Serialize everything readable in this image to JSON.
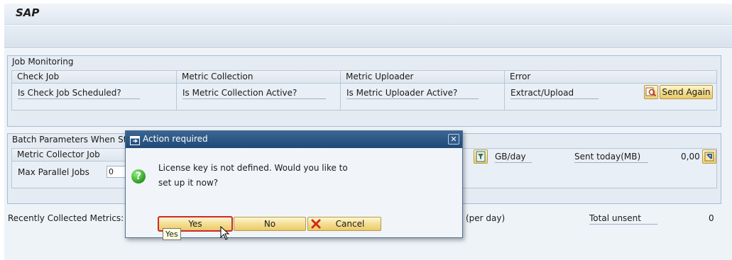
{
  "app": {
    "title": "SAP"
  },
  "job_monitoring": {
    "title": "Job Monitoring",
    "columns": [
      {
        "header": "Check Job",
        "label": "Is Check Job Scheduled?"
      },
      {
        "header": "Metric Collection",
        "label": "Is Metric Collection Active?"
      },
      {
        "header": "Metric Uploader",
        "label": "Is Metric Uploader Active?"
      },
      {
        "header": "Error",
        "label": "Extract/Upload"
      }
    ],
    "send_again_label": "Send Again"
  },
  "batch": {
    "title": "Batch Parameters When Star",
    "collector_header": "Metric Collector Job",
    "max_parallel_label": "Max Parallel Jobs",
    "max_parallel_value": "0",
    "gb_day_label": "GB/day",
    "sent_today_label": "Sent today(MB)",
    "sent_today_value": "0,00"
  },
  "footer": {
    "recent_label": "Recently Collected Metrics:",
    "per_day_label": "(per day)",
    "total_unsent_label": "Total unsent",
    "total_unsent_value": "0"
  },
  "dialog": {
    "title": "Action required",
    "message_line1": "License key is not defined. Would you like to",
    "message_line2": "set up it now?",
    "yes_label": "Yes",
    "no_label": "No",
    "cancel_label": "Cancel",
    "close_glyph": "✕",
    "tooltip": "Yes"
  },
  "icons": {
    "dialog_title_icon": "window-icon",
    "help_icon": "question-icon",
    "cancel_icon": "red-x-icon",
    "details_icon": "magnifier-icon",
    "filter_icon": "filter-icon",
    "export_icon": "export-icon"
  },
  "colors": {
    "button_yellow": "#f3dc8e",
    "dialog_header": "#2a5683",
    "help_green": "#2d9a22"
  }
}
